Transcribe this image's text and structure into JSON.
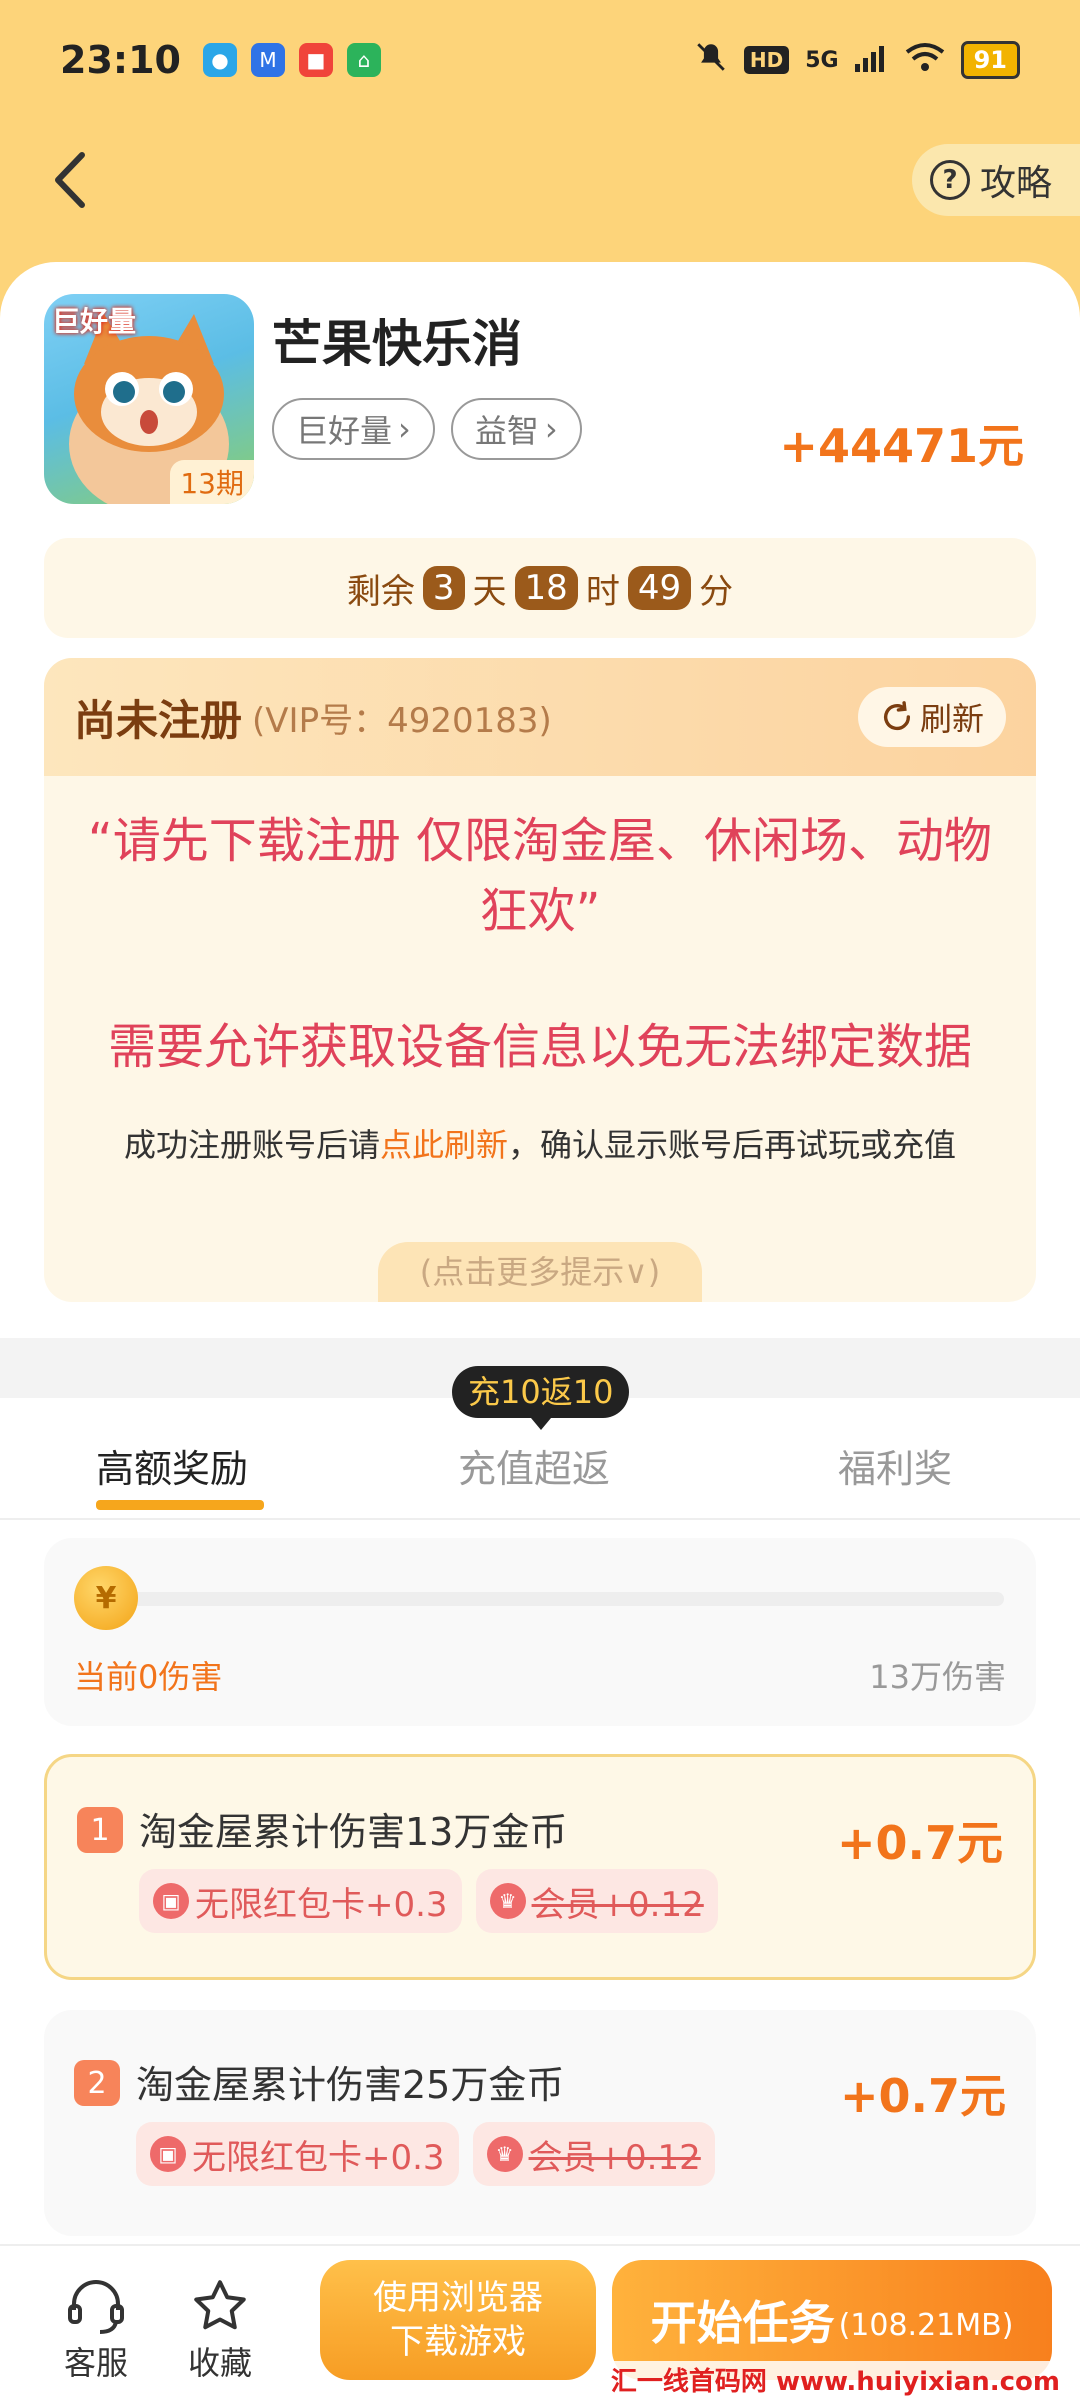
{
  "status_bar": {
    "time": "23:10",
    "network": "5G",
    "battery": "91",
    "notifications": [
      "app-notification-1-icon",
      "app-notification-2-icon",
      "app-notification-3-icon",
      "app-notification-4-icon"
    ]
  },
  "nav": {
    "guide_label": "攻略"
  },
  "game": {
    "name": "芒果快乐消",
    "icon_tag": "巨好量",
    "period": "13期",
    "tags": [
      "巨好量",
      "益智"
    ],
    "reward": "+44471元"
  },
  "countdown": {
    "prefix": "剩余",
    "days": "3",
    "days_unit": "天",
    "hours": "18",
    "hours_unit": "时",
    "minutes": "49",
    "minutes_unit": "分"
  },
  "registration": {
    "status": "尚未注册",
    "vip": "(VIP号：4920183)",
    "refresh_label": "刷新",
    "notice_1": "“请先下载注册 仅限淘金屋、休闲场、动物狂欢”",
    "notice_2": "需要允许获取设备信息以免无法绑定数据",
    "tip_prefix": "成功注册账号后请",
    "tip_link": "点此刷新",
    "tip_suffix": "，确认显示账号后再试玩或充值",
    "more_hints": "(点击更多提示∨)"
  },
  "tabs": {
    "items": [
      "高额奖励",
      "充值超返",
      "福利奖"
    ],
    "badge": "充10返10",
    "active": "高额奖励"
  },
  "progress": {
    "coin_symbol": "¥",
    "current_label": "当前0伤害",
    "max_label": "13万伤害",
    "fraction": 0
  },
  "tasks": [
    {
      "num": "1",
      "title": "淘金屋累计伤害13万金币",
      "amount": "+0.7元",
      "bonus_1": "无限红包卡+0.3",
      "bonus_2": "会员+0.12"
    },
    {
      "num": "2",
      "title": "淘金屋累计伤害25万金币",
      "amount": "+0.7元",
      "bonus_1": "无限红包卡+0.3",
      "bonus_2": "会员+0.12"
    }
  ],
  "bottom_bar": {
    "service_label": "客服",
    "favorite_label": "收藏",
    "browser_line1": "使用浏览器",
    "browser_line2": "下载游戏",
    "start_label": "开始任务",
    "start_size": "(108.21MB)"
  },
  "watermark": "汇一线首码网 www.huiyixian.com",
  "colors": {
    "header_bg": "#fdd47a",
    "accent_orange": "#f2741b",
    "notice_red": "#e0425a",
    "tab_underline": "#f6a61c"
  }
}
